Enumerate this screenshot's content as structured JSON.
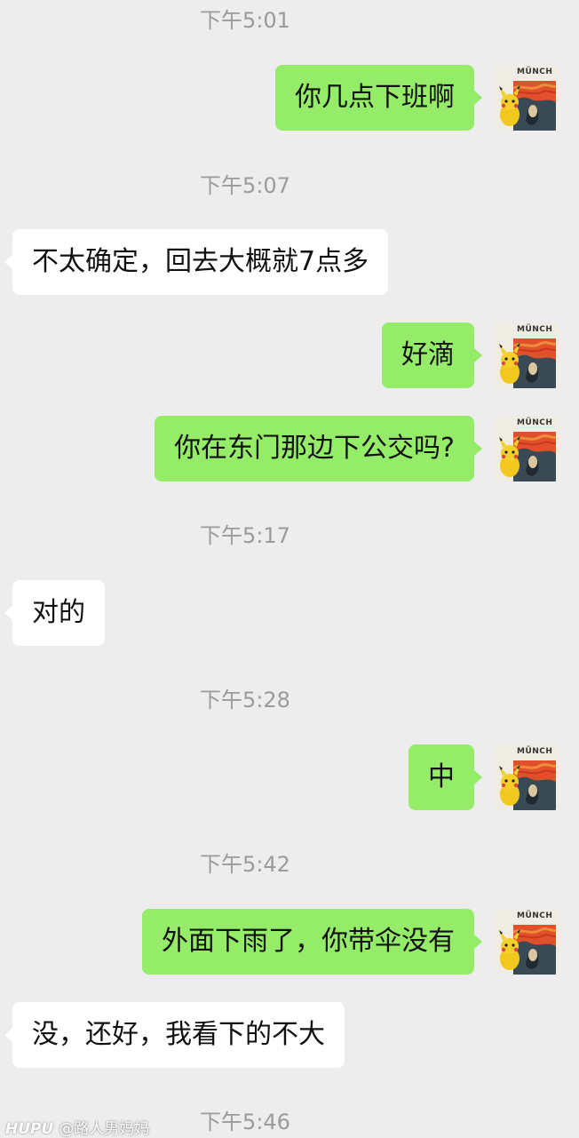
{
  "avatar": {
    "label": "MÜNCH"
  },
  "messages": [
    {
      "id": "ts1",
      "type": "timestamp",
      "text": "下午5:01"
    },
    {
      "id": "m1",
      "type": "sent",
      "text": "你几点下班啊"
    },
    {
      "id": "ts2",
      "type": "timestamp",
      "text": "下午5:07"
    },
    {
      "id": "m2",
      "type": "received",
      "text": "不太确定，回去大概就7点多"
    },
    {
      "id": "m3",
      "type": "sent",
      "text": "好滴"
    },
    {
      "id": "m4",
      "type": "sent",
      "text": "你在东门那边下公交吗?"
    },
    {
      "id": "ts3",
      "type": "timestamp",
      "text": "下午5:17"
    },
    {
      "id": "m5",
      "type": "received",
      "text": "对的"
    },
    {
      "id": "ts4",
      "type": "timestamp",
      "text": "下午5:28"
    },
    {
      "id": "m6",
      "type": "sent",
      "text": "中"
    },
    {
      "id": "ts5",
      "type": "timestamp",
      "text": "下午5:42"
    },
    {
      "id": "m7",
      "type": "sent",
      "text": "外面下雨了，你带伞没有"
    },
    {
      "id": "m8",
      "type": "received",
      "text": "没，还好，我看下的不大"
    },
    {
      "id": "ts6",
      "type": "timestamp",
      "text": "下午5:46"
    }
  ],
  "watermark": {
    "brand": "HUPU",
    "handle": "@路人男妈妈"
  },
  "colors": {
    "sent_bubble": "#95ec69",
    "received_bubble": "#ffffff",
    "background": "#ededed",
    "timestamp": "#9b9b9b"
  }
}
